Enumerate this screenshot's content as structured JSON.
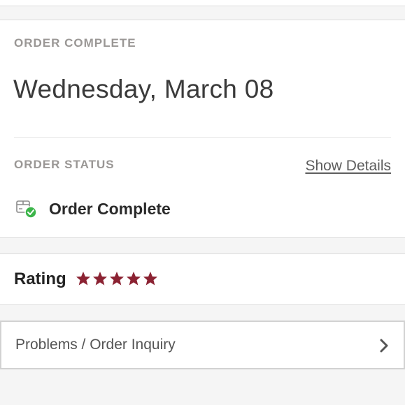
{
  "order": {
    "section_label": "ORDER COMPLETE",
    "date": "Wednesday, March 08",
    "status_label": "ORDER STATUS",
    "show_details": "Show Details",
    "status_text": "Order Complete",
    "status_icon": "package-check-icon"
  },
  "rating": {
    "label": "Rating",
    "stars": 5,
    "max_stars": 5,
    "star_color": "#8b2232"
  },
  "inquiry": {
    "label": "Problems / Order Inquiry",
    "chevron_icon": "chevron-right-icon"
  },
  "colors": {
    "success_green": "#3cb54a",
    "star": "#8b2232"
  }
}
